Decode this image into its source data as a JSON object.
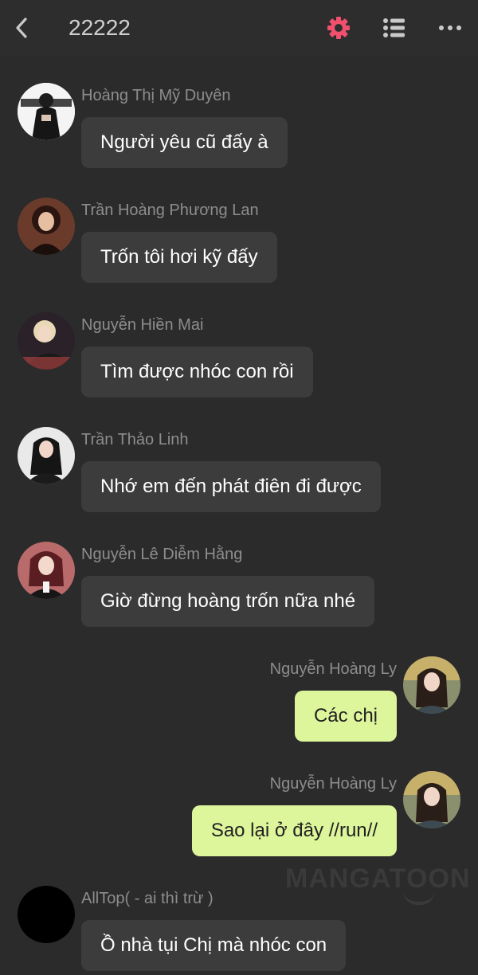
{
  "header": {
    "title": "22222",
    "accent_color": "#f0506e",
    "icons": [
      "back-arrow-icon",
      "gear-icon",
      "list-icon",
      "more-icon"
    ]
  },
  "colors": {
    "bubble_left": "#3c3c3c",
    "bubble_right": "#ddf59b",
    "background": "#2b2b2b"
  },
  "messages": [
    {
      "side": "left",
      "name": "Hoàng Thị Mỹ Duyên",
      "text": "Người yêu cũ đấy à"
    },
    {
      "side": "left",
      "name": "Trần Hoàng Phương Lan",
      "text": "Trốn tôi hơi kỹ đấy"
    },
    {
      "side": "left",
      "name": "Nguyễn Hiền Mai",
      "text": "Tìm được nhóc con rồi"
    },
    {
      "side": "left",
      "name": "Trần Thảo Linh",
      "text": "Nhớ em đến phát điên đi được"
    },
    {
      "side": "left",
      "name": "Nguyễn Lê Diễm Hằng",
      "text": "Giờ đừng hoàng trốn nữa nhé"
    },
    {
      "side": "right",
      "name": "Nguyễn Hoàng Ly",
      "text": "Các chị"
    },
    {
      "side": "right",
      "name": "Nguyễn Hoàng Ly",
      "text": "Sao lại ở đây //run//"
    },
    {
      "side": "left",
      "name": "AllTop( - ai thì trừ )",
      "text": "Ồ nhà tụi Chị mà nhóc con"
    }
  ],
  "watermark": "MANGATOON"
}
